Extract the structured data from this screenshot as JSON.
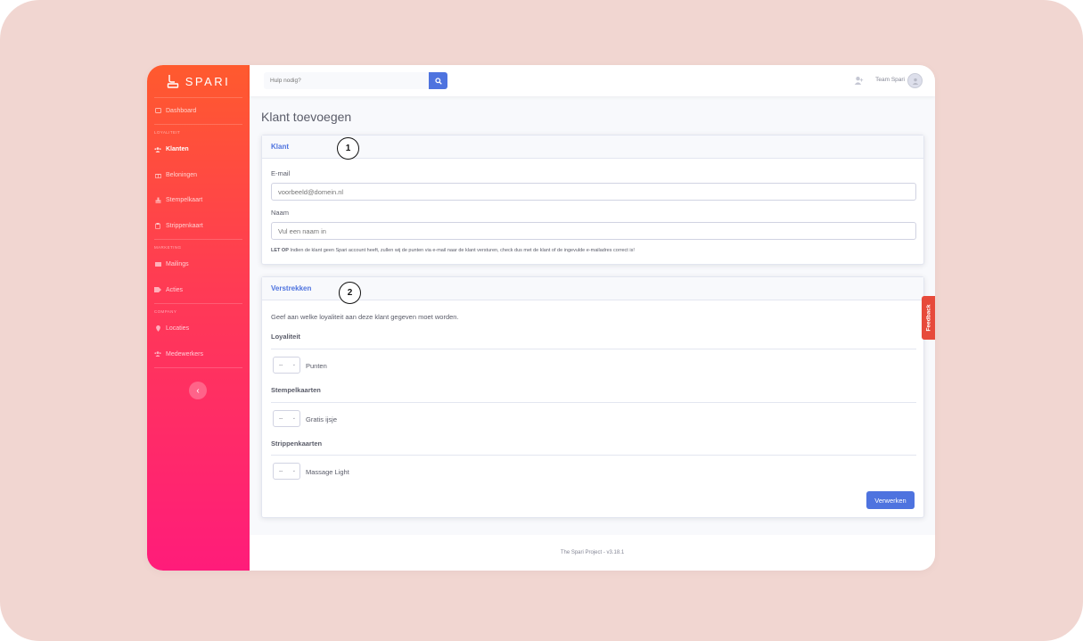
{
  "brand": {
    "name": "SPARI"
  },
  "sidebar": {
    "sections": [
      {
        "heading": "",
        "items": [
          {
            "label": "Dashboard",
            "icon": "dashboard-icon"
          }
        ]
      },
      {
        "heading": "LOYALITEIT",
        "items": [
          {
            "label": "Klanten",
            "icon": "users-icon"
          },
          {
            "label": "Beloningen",
            "icon": "gift-icon"
          },
          {
            "label": "Stempelkaart",
            "icon": "stamp-icon"
          },
          {
            "label": "Strippenkaart",
            "icon": "clipboard-icon"
          }
        ]
      },
      {
        "heading": "MARKETING",
        "items": [
          {
            "label": "Mailings",
            "icon": "envelope-icon"
          },
          {
            "label": "Acties",
            "icon": "tag-icon"
          }
        ]
      },
      {
        "heading": "COMPANY",
        "items": [
          {
            "label": "Locaties",
            "icon": "map-pin-icon"
          },
          {
            "label": "Medewerkers",
            "icon": "team-icon"
          }
        ]
      }
    ],
    "active": "Klanten"
  },
  "topbar": {
    "search_placeholder": "Hulp nodig?",
    "user_name": "Team Spari"
  },
  "page": {
    "title": "Klant toevoegen"
  },
  "klant_card": {
    "header": "Klant",
    "step": "1",
    "email_label": "E-mail",
    "email_placeholder": "voorbeeld@domein.nl",
    "name_label": "Naam",
    "name_placeholder": "Vul een naam in",
    "note_strong": "LET OP",
    "note_text": " Indien de klant geen Spari account heeft, zullen wij de punten via e-mail naar de klant versturen, check dus met de klant of de ingevulde e-mailadres correct is!"
  },
  "verstrekken_card": {
    "header": "Verstrekken",
    "step": "2",
    "intro": "Geef aan welke loyaliteit aan deze klant gegeven moet worden.",
    "sections": [
      {
        "title": "Loyaliteit",
        "select_value": "--",
        "option_label": "Punten"
      },
      {
        "title": "Stempelkaarten",
        "select_value": "--",
        "option_label": "Gratis ijsje"
      },
      {
        "title": "Strippenkaarten",
        "select_value": "--",
        "option_label": "Massage Light"
      }
    ],
    "submit_label": "Verwerken"
  },
  "feedback_label": "Feedback",
  "footer": {
    "text": "The Spari Project - v3.18.1"
  },
  "colors": {
    "primary": "#4e73df",
    "sidebar_top": "#ff5a2e",
    "sidebar_bottom": "#ff1c7a",
    "feedback": "#e74a3b"
  }
}
